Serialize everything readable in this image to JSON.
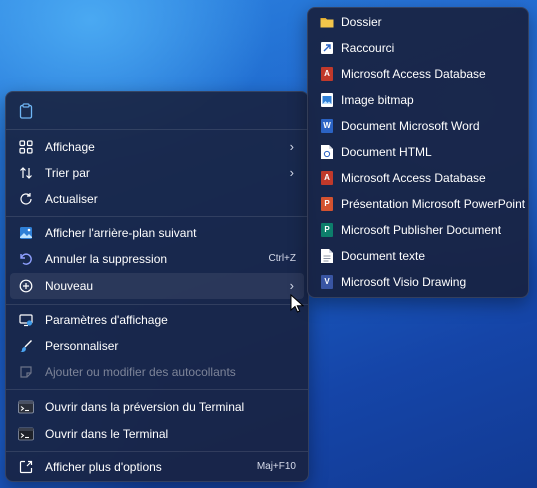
{
  "menu": {
    "clipboard_icon": "clipboard-icon",
    "items": [
      {
        "label": "Affichage",
        "icon": "grid-icon",
        "chevron": "›"
      },
      {
        "label": "Trier par",
        "icon": "sort-icon",
        "chevron": "›"
      },
      {
        "label": "Actualiser",
        "icon": "refresh-icon"
      },
      {
        "label": "Afficher l'arrière-plan suivant",
        "icon": "wallpaper-icon"
      },
      {
        "label": "Annuler la suppression",
        "icon": "undo-icon",
        "shortcut": "Ctrl+Z"
      },
      {
        "label": "Nouveau",
        "icon": "add-circle-icon",
        "chevron": "›"
      },
      {
        "label": "Paramètres d'affichage",
        "icon": "display-settings-icon"
      },
      {
        "label": "Personnaliser",
        "icon": "brush-icon"
      },
      {
        "label": "Ajouter ou modifier des autocollants",
        "icon": "sticker-icon"
      },
      {
        "label": "Ouvrir dans la préversion du Terminal",
        "icon": "terminal-preview-icon"
      },
      {
        "label": "Ouvrir dans le Terminal",
        "icon": "terminal-icon"
      },
      {
        "label": "Afficher plus d'options",
        "icon": "more-options-icon",
        "shortcut": "Maj+F10"
      }
    ]
  },
  "submenu": {
    "items": [
      {
        "label": "Dossier",
        "icon": "folder-icon"
      },
      {
        "label": "Raccourci",
        "icon": "shortcut-icon"
      },
      {
        "label": "Microsoft Access Database",
        "icon": "access-icon"
      },
      {
        "label": "Image bitmap",
        "icon": "bitmap-icon"
      },
      {
        "label": "Document Microsoft Word",
        "icon": "word-icon"
      },
      {
        "label": "Document HTML",
        "icon": "html-icon"
      },
      {
        "label": "Microsoft Access Database",
        "icon": "access-icon"
      },
      {
        "label": "Présentation Microsoft PowerPoint",
        "icon": "powerpoint-icon"
      },
      {
        "label": "Microsoft Publisher Document",
        "icon": "publisher-icon"
      },
      {
        "label": "Document texte",
        "icon": "text-file-icon"
      },
      {
        "label": "Microsoft Visio Drawing",
        "icon": "visio-icon"
      }
    ]
  },
  "colors": {
    "menu_bg": "#182240",
    "accent": "#4aa3f0",
    "access": "#c0392b",
    "word": "#2b63c4",
    "powerpoint": "#d35230",
    "publisher": "#0d7e6b",
    "visio": "#3955a3",
    "folder": "#f3c64b"
  }
}
